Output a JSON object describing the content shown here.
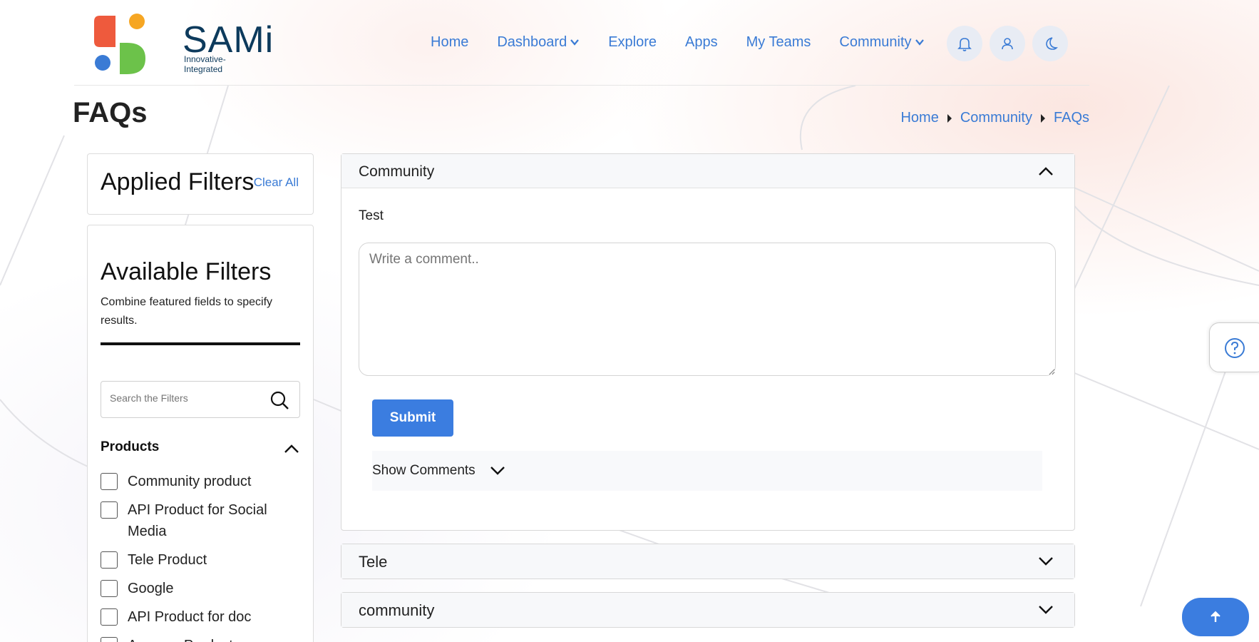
{
  "brand": {
    "name": "SAMi",
    "tagline": "Innovative-Integrated"
  },
  "nav": {
    "items": [
      {
        "label": "Home"
      },
      {
        "label": "Dashboard"
      },
      {
        "label": "Explore"
      },
      {
        "label": "Apps"
      },
      {
        "label": "My Teams"
      },
      {
        "label": "Community"
      }
    ]
  },
  "page": {
    "title": "FAQs"
  },
  "breadcrumb": [
    "Home",
    "Community",
    "FAQs"
  ],
  "filters": {
    "applied_title": "Applied Filters",
    "clear_all": "Clear All",
    "available_title": "Available Filters",
    "description": "Combine featured fields to specify results.",
    "search_placeholder": "Search the Filters",
    "products_heading": "Products",
    "products": [
      "Community product",
      "API Product for Social Media",
      "Tele Product",
      "Google",
      "API Product for doc",
      "Amazon Product"
    ]
  },
  "faq": {
    "open": {
      "title": "Community",
      "body": "Test",
      "comment_placeholder": "Write a comment..",
      "submit_label": "Submit",
      "show_comments": "Show Comments"
    },
    "closed": [
      {
        "title": "Tele"
      },
      {
        "title": "community"
      }
    ]
  },
  "colors": {
    "accent": "#3b7de0",
    "link": "#3a7bd5",
    "brand_dark": "#0d3a5c"
  }
}
